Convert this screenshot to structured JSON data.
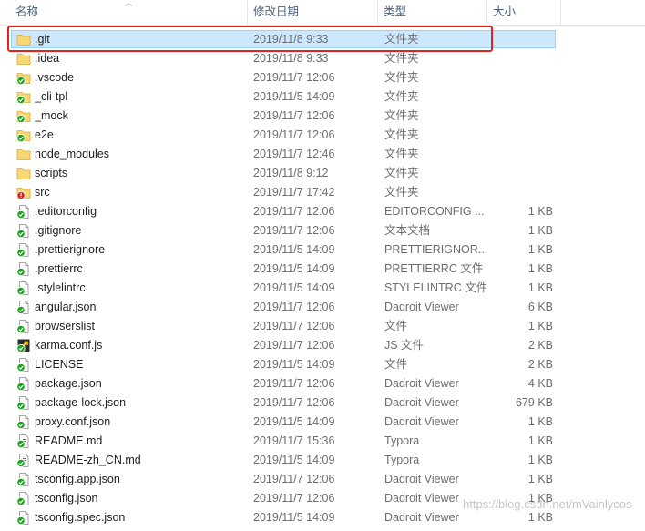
{
  "columns": {
    "name": "名称",
    "date": "修改日期",
    "type": "类型",
    "size": "大小"
  },
  "colors": {
    "accent_red": "#e3211f",
    "selected_bg": "#cce8ff",
    "folder": "#f8d775",
    "sync_green": "#1aa31a",
    "error_red": "#d9231b"
  },
  "files": [
    {
      "name": ".git",
      "date": "2019/11/8 9:33",
      "type": "文件夹",
      "size": "",
      "icon": "folder-icon",
      "selected": true
    },
    {
      "name": ".idea",
      "date": "2019/11/8 9:33",
      "type": "文件夹",
      "size": "",
      "icon": "folder-icon"
    },
    {
      "name": ".vscode",
      "date": "2019/11/7 12:06",
      "type": "文件夹",
      "size": "",
      "icon": "folder-synced-icon"
    },
    {
      "name": "_cli-tpl",
      "date": "2019/11/5 14:09",
      "type": "文件夹",
      "size": "",
      "icon": "folder-synced-icon"
    },
    {
      "name": "_mock",
      "date": "2019/11/7 12:06",
      "type": "文件夹",
      "size": "",
      "icon": "folder-synced-icon"
    },
    {
      "name": "e2e",
      "date": "2019/11/7 12:06",
      "type": "文件夹",
      "size": "",
      "icon": "folder-synced-icon"
    },
    {
      "name": "node_modules",
      "date": "2019/11/7 12:46",
      "type": "文件夹",
      "size": "",
      "icon": "folder-icon"
    },
    {
      "name": "scripts",
      "date": "2019/11/8 9:12",
      "type": "文件夹",
      "size": "",
      "icon": "folder-icon"
    },
    {
      "name": "src",
      "date": "2019/11/7 17:42",
      "type": "文件夹",
      "size": "",
      "icon": "folder-error-icon"
    },
    {
      "name": ".editorconfig",
      "date": "2019/11/7 12:06",
      "type": "EDITORCONFIG ...",
      "size": "1 KB",
      "icon": "file-synced-icon"
    },
    {
      "name": ".gitignore",
      "date": "2019/11/7 12:06",
      "type": "文本文档",
      "size": "1 KB",
      "icon": "file-synced-icon"
    },
    {
      "name": ".prettierignore",
      "date": "2019/11/5 14:09",
      "type": "PRETTIERIGNOR...",
      "size": "1 KB",
      "icon": "file-synced-icon"
    },
    {
      "name": ".prettierrc",
      "date": "2019/11/5 14:09",
      "type": "PRETTIERRC 文件",
      "size": "1 KB",
      "icon": "file-synced-icon"
    },
    {
      "name": ".stylelintrc",
      "date": "2019/11/5 14:09",
      "type": "STYLELINTRC 文件",
      "size": "1 KB",
      "icon": "file-synced-icon"
    },
    {
      "name": "angular.json",
      "date": "2019/11/7 12:06",
      "type": "Dadroit Viewer",
      "size": "6 KB",
      "icon": "file-synced-icon"
    },
    {
      "name": "browserslist",
      "date": "2019/11/7 12:06",
      "type": "文件",
      "size": "1 KB",
      "icon": "file-synced-icon"
    },
    {
      "name": "karma.conf.js",
      "date": "2019/11/7 12:06",
      "type": "JS 文件",
      "size": "2 KB",
      "icon": "js-file-icon"
    },
    {
      "name": "LICENSE",
      "date": "2019/11/5 14:09",
      "type": "文件",
      "size": "2 KB",
      "icon": "file-synced-icon"
    },
    {
      "name": "package.json",
      "date": "2019/11/7 12:06",
      "type": "Dadroit Viewer",
      "size": "4 KB",
      "icon": "file-synced-icon"
    },
    {
      "name": "package-lock.json",
      "date": "2019/11/7 12:06",
      "type": "Dadroit Viewer",
      "size": "679 KB",
      "icon": "file-synced-icon"
    },
    {
      "name": "proxy.conf.json",
      "date": "2019/11/5 14:09",
      "type": "Dadroit Viewer",
      "size": "1 KB",
      "icon": "file-synced-icon"
    },
    {
      "name": "README.md",
      "date": "2019/11/7 15:36",
      "type": "Typora",
      "size": "1 KB",
      "icon": "typora-file-icon"
    },
    {
      "name": "README-zh_CN.md",
      "date": "2019/11/5 14:09",
      "type": "Typora",
      "size": "1 KB",
      "icon": "typora-file-icon"
    },
    {
      "name": "tsconfig.app.json",
      "date": "2019/11/7 12:06",
      "type": "Dadroit Viewer",
      "size": "1 KB",
      "icon": "file-synced-icon"
    },
    {
      "name": "tsconfig.json",
      "date": "2019/11/7 12:06",
      "type": "Dadroit Viewer",
      "size": "1 KB",
      "icon": "file-synced-icon"
    },
    {
      "name": "tsconfig.spec.json",
      "date": "2019/11/5 14:09",
      "type": "Dadroit Viewer",
      "size": "1 KB",
      "icon": "file-synced-icon"
    }
  ],
  "watermark": "https://blog.csdn.net/mVainlycos"
}
